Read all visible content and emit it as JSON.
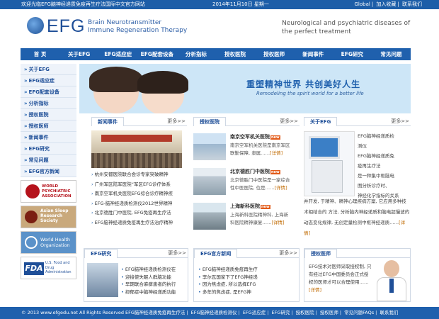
{
  "topbar": {
    "welcome": "欢迎光临EFG脑神经递质免疫再生疗法国际中文官方网站",
    "date": "2014年11月10日 星期一",
    "links": [
      "Global",
      "加入收藏",
      "联系我们"
    ]
  },
  "header": {
    "logo": "EFG",
    "logo_sub_1": "Brain Neurotransmitter",
    "logo_sub_2": "Immune Regeneration Therapy",
    "slogan": "Neurological and psychiatric diseases of the perfect treatment"
  },
  "nav": [
    "首  页",
    "关于EFG",
    "EFG适应症",
    "EFG配套设备",
    "分析指标",
    "授权医院",
    "授权医师",
    "新闻事件",
    "EFG研究",
    "常见问题"
  ],
  "sidebar": [
    "关于EFG",
    "EFG适应症",
    "EFG配套设备",
    "分析指标",
    "授权医院",
    "授权医师",
    "新闻事件",
    "EFG研究",
    "常见问题",
    "EFG官方新闻"
  ],
  "badges": {
    "wpa": "WORLD PSYCHIATRIC ASSOCIATION",
    "assr": "Asian Sleep Research Society",
    "who": "World Health Organization",
    "fda_big": "FDA",
    "fda_small": "U.S. Food and Drug Administration"
  },
  "banner": {
    "cn": "重塑精神世界 共创美好人生",
    "en": "Remodeling the spirit world for a better life"
  },
  "news": {
    "title": "新闻事件",
    "more": "更多>>",
    "items": [
      "杭州安都医院联合会诊专家突破精神",
      "广州军区陆军医院“军区EFG诊疗体系",
      "南京空军机关医院EFG综合诊疗精神疾",
      "EFG-脑神经递质检测仪2012世界精神",
      "北京德胜门中医院, EFG免疫再生疗法",
      "EFG脑神经递质免疫再生疗法治疗精神"
    ]
  },
  "hospitals": {
    "title": "授权医院",
    "more": "更多>>",
    "items": [
      {
        "name": "南京空军机关医院",
        "desc": "南京空军机关医院是南京军区联勤保障, 隶属……",
        "detail": "[详情]"
      },
      {
        "name": "北京德胜门中医院",
        "desc": "北京德胜门中医院是一家综合性中医医院, 位是……",
        "detail": "[详情]"
      },
      {
        "name": "上海新科医院",
        "desc": "上海新科医院精神科, 上海新科医院精神康复……",
        "detail": "[详情]"
      }
    ]
  },
  "about": {
    "title": "关于EFG",
    "more": "更多>>",
    "text_right": [
      "EFG脑神经递质检",
      "测仪",
      "EFG脑神经递质免",
      "疫再生疗法",
      "是一种集中枢脑电",
      "图分析诊疗时、",
      "神经化学指标的关系"
    ],
    "text_bottom": "并开发, 于精神、精神心理疾病方案, 它应用多种技术相结合的 方法, 分析脑内神经递质和脑电超慢波的动态变化规律, 无创定量检测中枢神经递质……",
    "detail": "[详情]"
  },
  "research": {
    "title": "EFG研究",
    "more": "更多>>",
    "items": [
      "EFG脑神经递质检测仪在",
      "迎接使失眠人群脑功能",
      "早期联合麻痹患者的执行",
      "抑郁症中脑神经递质功能"
    ]
  },
  "official": {
    "title": "EFG官方新闻",
    "more": "更多>>",
    "items": [
      "EFG脑神经递质免疫再生疗",
      "李尔瓦国家下了EFG神经递",
      "因为焦虑症, 所以选择EFG",
      "多年的焦虑症, 是EFG神"
    ]
  },
  "doctors": {
    "title": "授权医师",
    "text": "EFG技术对医师采取授权制, 只有经过EFG中国委员会正式授权的医师才可以合理使用……",
    "detail": "[详情]"
  },
  "footer": {
    "copy": "© 2013 www.efgedu.net All Rights Reserved",
    "links": [
      "EFG脑神经递质免疫再生疗法",
      "EFG脑神经递质检测仪",
      "EFG适应症",
      "EFG研究",
      "授权医院",
      "授权医师",
      "常见问题FAQs",
      "联系我们"
    ]
  },
  "colors": {
    "brand": "#1f60ad",
    "nav": "#1f60ad",
    "accent": "#c06a00"
  }
}
